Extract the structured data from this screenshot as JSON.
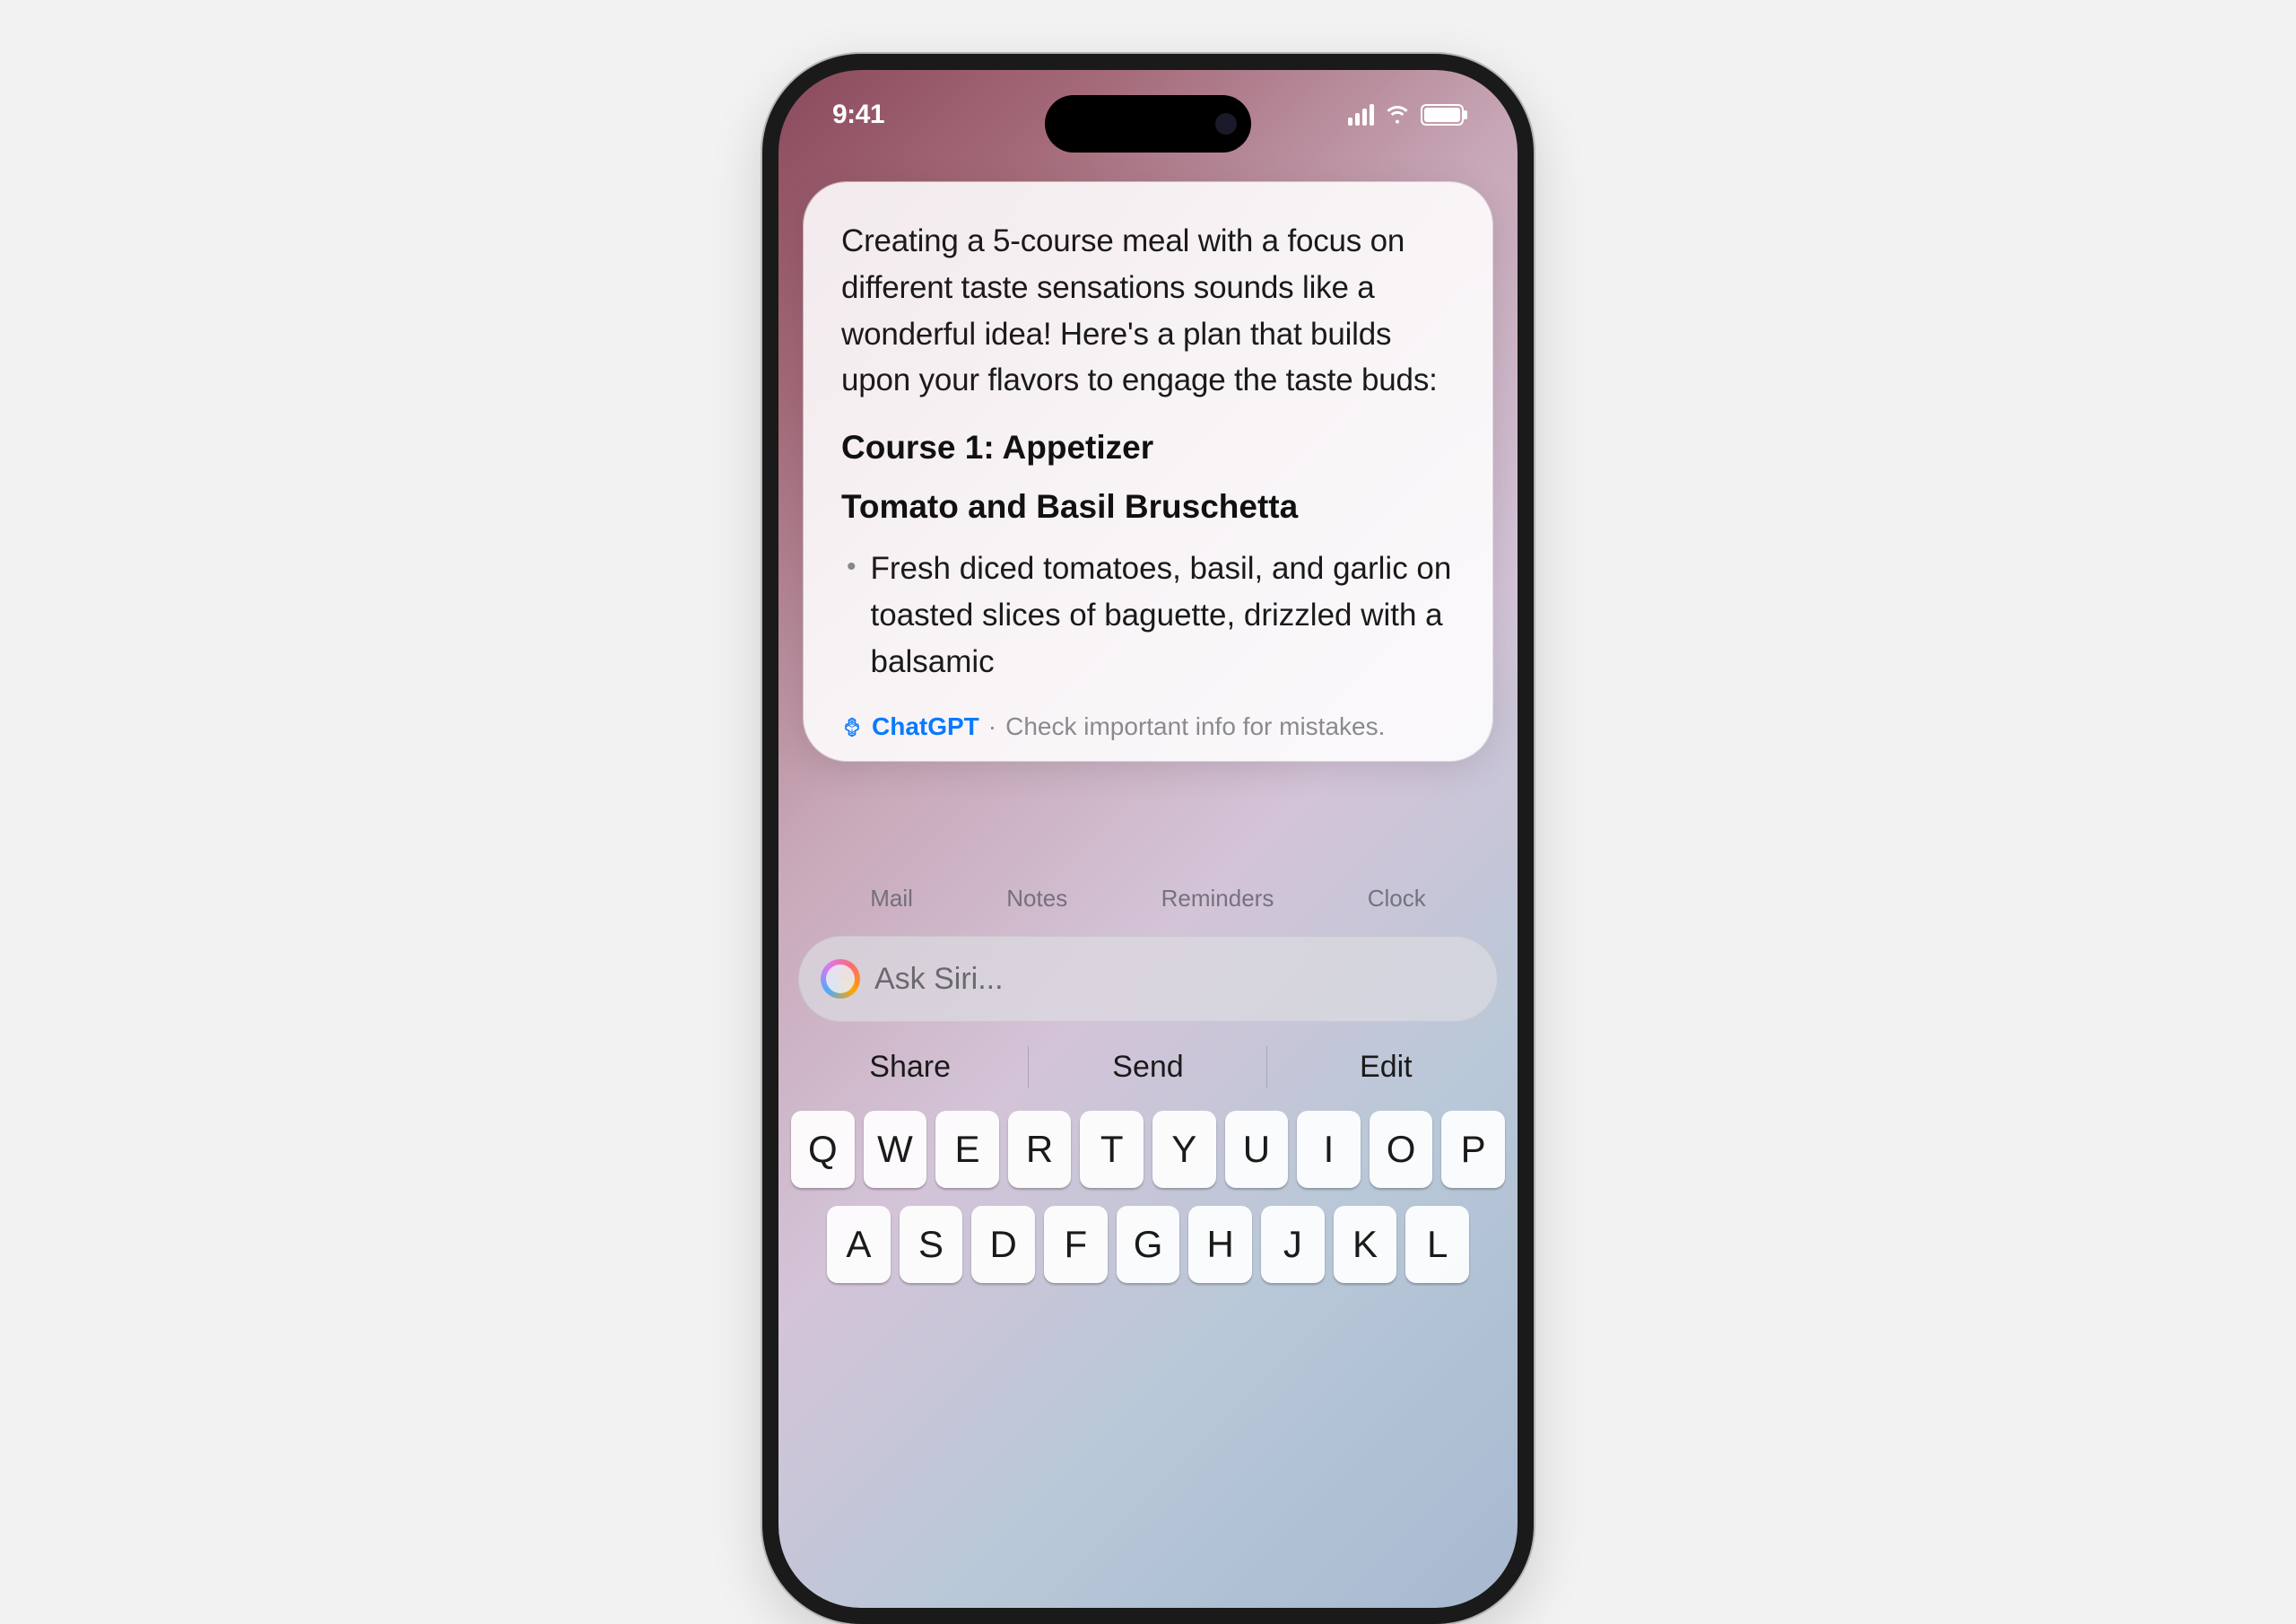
{
  "status": {
    "time": "9:41"
  },
  "response": {
    "intro": "Creating a 5-course meal with a focus on different taste sensations sounds like a wonderful idea! Here's a plan that builds upon your flavors to engage the taste buds:",
    "course_heading": "Course 1: Appetizer",
    "dish_name": "Tomato and Basil Bruschetta",
    "bullet": "Fresh diced tomatoes, basil, and garlic on toasted slices of baguette, drizzled with a balsamic"
  },
  "attribution": {
    "name": "ChatGPT",
    "separator": "·",
    "warning": "Check important info for mistakes."
  },
  "apps": [
    "Mail",
    "Notes",
    "Reminders",
    "Clock"
  ],
  "siri": {
    "placeholder": "Ask Siri..."
  },
  "suggestions": [
    "Share",
    "Send",
    "Edit"
  ],
  "keyboard": {
    "row1": [
      "Q",
      "W",
      "E",
      "R",
      "T",
      "Y",
      "U",
      "I",
      "O",
      "P"
    ],
    "row2": [
      "A",
      "S",
      "D",
      "F",
      "G",
      "H",
      "J",
      "K",
      "L"
    ]
  }
}
